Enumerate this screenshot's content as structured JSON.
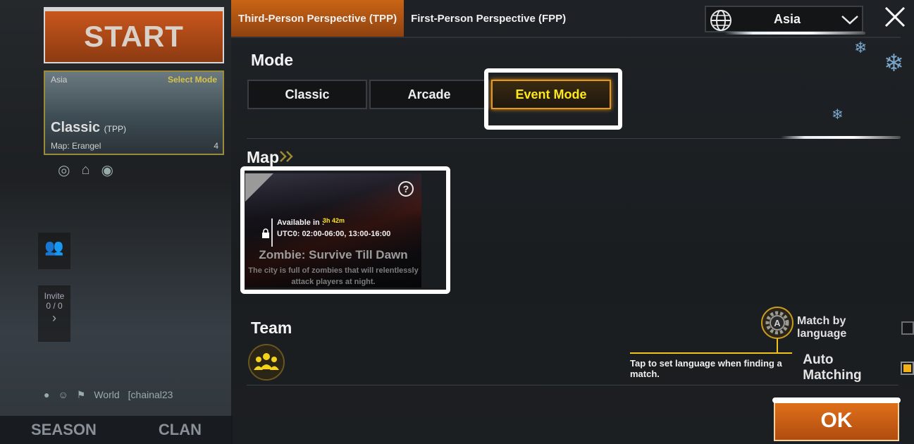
{
  "lobby": {
    "start_label": "START",
    "mode_card": {
      "region": "Asia",
      "select_mode": "Select Mode",
      "mode": "Classic",
      "perspective": "(TPP)",
      "map": "Map: Erangel",
      "squad_count": "4"
    },
    "invite_label": "Invite",
    "invite_count": "0 / 0",
    "chat_channel": "World",
    "chat_user": "[chainal23",
    "tabs": [
      "SEASON",
      "CLAN"
    ]
  },
  "dialog": {
    "perspective_tabs": [
      {
        "label": "Third-Person Perspective (TPP)",
        "active": true
      },
      {
        "label": "First-Person Perspective (FPP)",
        "active": false
      }
    ],
    "region_select": {
      "value": "Asia",
      "icon": "globe-icon"
    },
    "mode_section": {
      "title": "Mode",
      "options": [
        {
          "label": "Classic",
          "selected": false
        },
        {
          "label": "Arcade",
          "selected": false
        },
        {
          "label": "Event Mode",
          "selected": true
        }
      ]
    },
    "map_section": {
      "title": "Map",
      "card": {
        "available_label": "Available in",
        "colon": ":",
        "timer": "3h 42m",
        "hours": "UTC0: 02:00-06:00, 13:00-16:00",
        "name": "Zombie: Survive Till Dawn",
        "description": "The city is full of zombies that will relentlessly attack players at night."
      }
    },
    "team_section": {
      "title": "Team",
      "match_by_language": {
        "label": "Match by language",
        "checked": false
      },
      "auto_matching": {
        "label": "Auto Matching",
        "prefix": "/",
        "checked": true
      },
      "tooltip": "Tap to set language when finding a match."
    },
    "ok_label": "OK"
  },
  "colors": {
    "accent_orange": "#c96414",
    "selected_text": "#ffe81a",
    "highlight_box": "#ffffff",
    "checkbox_fill": "#f3b21a"
  }
}
